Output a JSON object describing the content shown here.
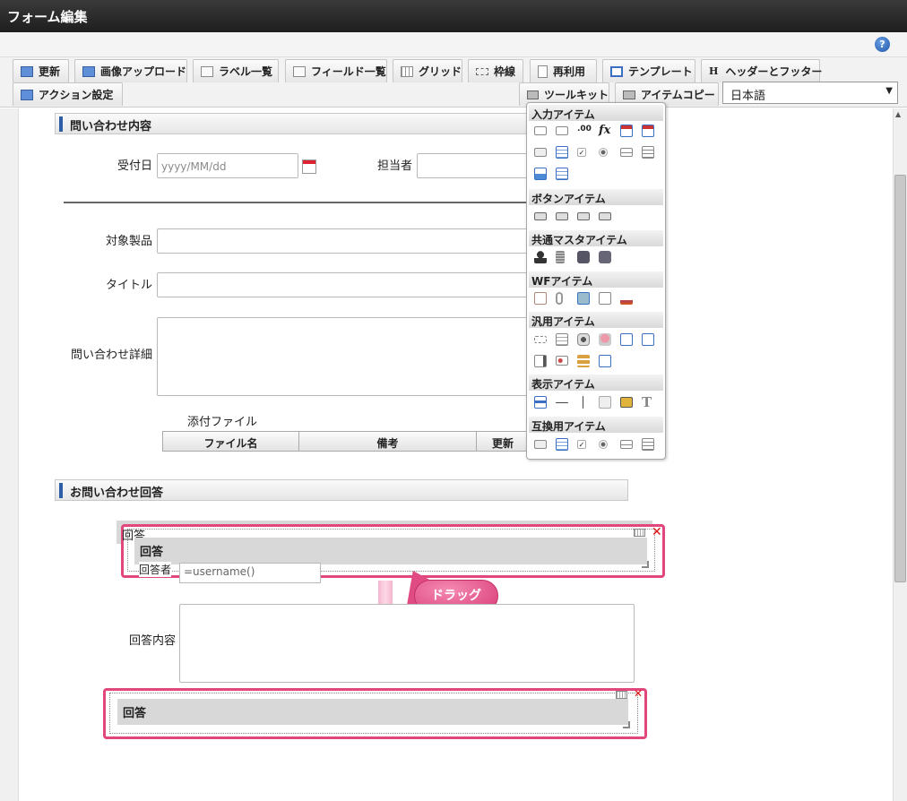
{
  "window": {
    "title": "フォーム編集"
  },
  "toolbar": {
    "tabs": [
      {
        "label": "更新",
        "icon": "update-icon"
      },
      {
        "label": "画像アップロード",
        "icon": "image-upload-icon"
      },
      {
        "label": "ラベル一覧",
        "icon": "label-list-icon"
      },
      {
        "label": "フィールド一覧",
        "icon": "field-list-icon"
      },
      {
        "label": "グリッド",
        "icon": "grid-icon"
      },
      {
        "label": "枠線",
        "icon": "border-icon"
      },
      {
        "label": "再利用",
        "icon": "reuse-icon"
      },
      {
        "label": "テンプレート",
        "icon": "template-icon"
      },
      {
        "label": "ヘッダーとフッター",
        "icon": "header-footer-icon",
        "glyph": "H"
      },
      {
        "label": "アクション設定",
        "icon": "action-icon"
      },
      {
        "label": "ツールキット",
        "icon": "toolkit-icon"
      },
      {
        "label": "アイテムコピー",
        "icon": "item-copy-icon"
      }
    ],
    "language": "日本語"
  },
  "form": {
    "section1": "問い合わせ内容",
    "received_label": "受付日",
    "received_placeholder": "yyyy/MM/dd",
    "assignee_label": "担当者",
    "product_label": "対象製品",
    "title_label": "タイトル",
    "detail_label": "問い合わせ詳細",
    "attach_label": "添付ファイル",
    "attach_cols": [
      "ファイル名",
      "備考",
      "更新"
    ],
    "section2": "お問い合わせ回答",
    "answer_group_label": "回答",
    "answer_inner_label": "回答",
    "responder_label": "回答者",
    "responder_value": "=username()",
    "answer_content_label": "回答内容",
    "drop_label": "回答",
    "drag_callout": "ドラッグ"
  },
  "palette": {
    "categories": [
      "入力アイテム",
      "ボタンアイテム",
      "共通マスタアイテム",
      "WFアイテム",
      "汎用アイテム",
      "表示アイテム",
      "互換用アイテム"
    ],
    "fx_glyph": "fx",
    "num_glyph": ".00",
    "text_glyph": "T"
  },
  "colors": {
    "highlight": "#e1477d",
    "section_bar": "#2e5da8",
    "callout": "#d93b78"
  }
}
